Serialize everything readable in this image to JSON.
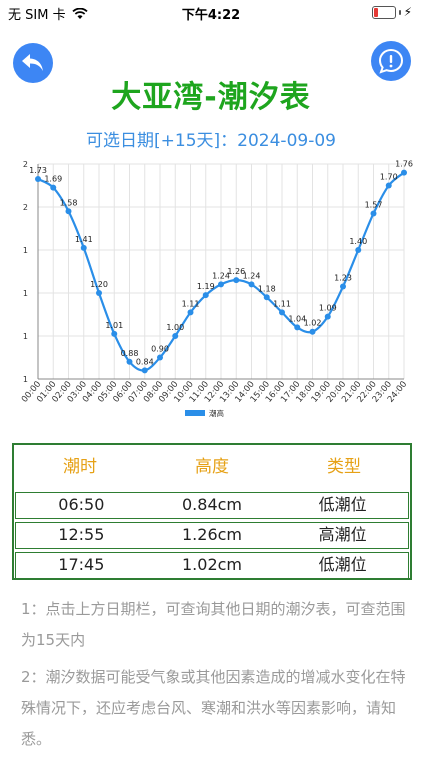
{
  "status_bar": {
    "carrier": "无 SIM 卡",
    "time": "下午4:22",
    "battery_level": 0.2
  },
  "header": {
    "back_icon": "back-arrow-icon",
    "info_icon": "exclamation-icon",
    "title": "大亚湾-潮汐表",
    "date_text": "可选日期[+15天]：2024-09-09"
  },
  "chart_data": {
    "type": "line",
    "x": [
      "00:00",
      "01:00",
      "02:00",
      "03:00",
      "04:00",
      "05:00",
      "06:00",
      "07:00",
      "08:00",
      "09:00",
      "10:00",
      "11:00",
      "12:00",
      "13:00",
      "14:00",
      "15:00",
      "16:00",
      "17:00",
      "18:00",
      "19:00",
      "20:00",
      "21:00",
      "22:00",
      "23:00",
      "24:00"
    ],
    "series": [
      {
        "name": "潮高",
        "values": [
          1.73,
          1.69,
          1.58,
          1.41,
          1.2,
          1.01,
          0.88,
          0.84,
          0.9,
          1.0,
          1.11,
          1.19,
          1.24,
          1.26,
          1.24,
          1.18,
          1.11,
          1.04,
          1.02,
          1.09,
          1.23,
          1.4,
          1.57,
          1.7,
          1.76
        ]
      }
    ],
    "ylim": [
      0.8,
      1.8
    ],
    "ytick_labels": [
      "1",
      "1",
      "1",
      "1",
      "2",
      "2"
    ],
    "grid": true,
    "legend": "bottom-center",
    "line_color": "#2a8ee8"
  },
  "table": {
    "headers": [
      "潮时",
      "高度",
      "类型"
    ],
    "rows": [
      [
        "06:50",
        "0.84cm",
        "低潮位"
      ],
      [
        "12:55",
        "1.26cm",
        "高潮位"
      ],
      [
        "17:45",
        "1.02cm",
        "低潮位"
      ]
    ]
  },
  "notes": [
    "1：点击上方日期栏，可查询其他日期的潮汐表，可查范围为15天内",
    "2：潮汐数据可能受气象或其他因素造成的增减水变化在特殊情况下，还应考虑台风、寒潮和洪水等因素影响，请知悉。"
  ]
}
